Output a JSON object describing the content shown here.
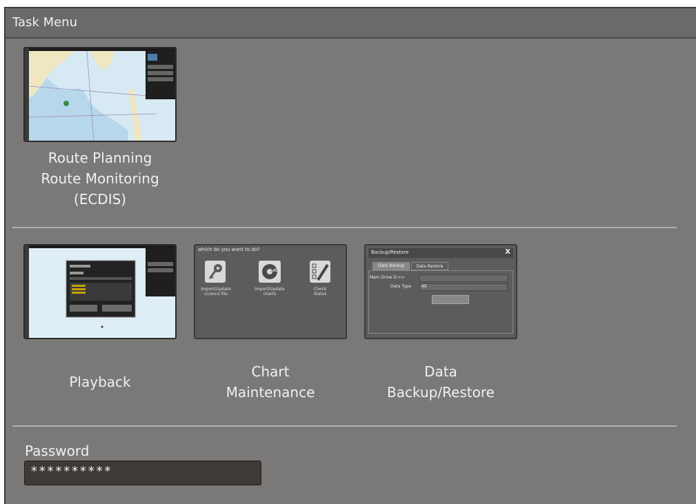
{
  "window": {
    "title": "Task Menu"
  },
  "tasks": [
    {
      "id": "ecdis",
      "label_lines": [
        "Route Planning",
        "Route Monitoring",
        "(ECDIS)"
      ],
      "icon": "chart-display-thumbnail"
    },
    {
      "id": "playback",
      "label_lines": [
        "Playback"
      ],
      "icon": "playback-thumbnail"
    },
    {
      "id": "chart-maintenance",
      "label_lines": [
        "Chart",
        "Maintenance"
      ],
      "icon": "chart-maintenance-thumbnail",
      "preview": {
        "prompt": "which do you want to do?",
        "items": [
          {
            "label_lines": [
              "Import/Update",
              "Licence file"
            ],
            "icon": "key-icon"
          },
          {
            "label_lines": [
              "Import/Update",
              "charts"
            ],
            "icon": "disc-icon"
          },
          {
            "label_lines": [
              "Check",
              "Status"
            ],
            "icon": "checklist-icon"
          }
        ]
      }
    },
    {
      "id": "data-backup",
      "label_lines": [
        "Data",
        "Backup/Restore"
      ],
      "icon": "backup-restore-thumbnail",
      "preview": {
        "title": "Backup/Restore",
        "close": "X",
        "tabs": [
          "Data Backup",
          "Data Restore"
        ],
        "main_drive_label": "Main Drive D:>>",
        "data_type_label": "Data Type",
        "data_type_value": "All"
      }
    }
  ],
  "password": {
    "label": "Password",
    "value": "**********"
  },
  "colors": {
    "background": "#7b7977",
    "titlebar": "#6c6a68",
    "text": "#f0f0f0",
    "input_bg": "#3d3a38"
  }
}
